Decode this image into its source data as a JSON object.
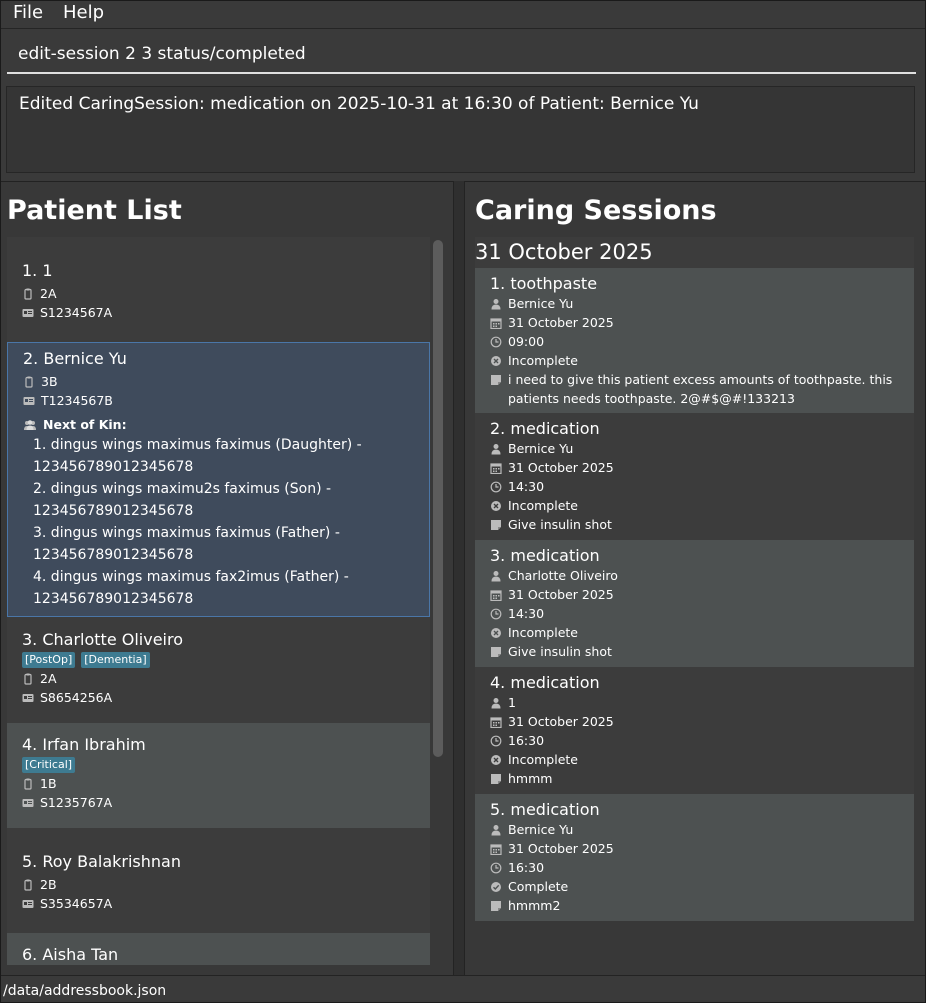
{
  "menu": {
    "file": "File",
    "help": "Help"
  },
  "command": {
    "value": "edit-session 2 3 status/completed"
  },
  "result": {
    "message": "Edited CaringSession: medication on 2025-10-31 at 16:30 of Patient: Bernice Yu"
  },
  "patient_list": {
    "title": "Patient List",
    "patients": [
      {
        "index_name": "1. 1",
        "ward": "2A",
        "nric": "S1234567A"
      },
      {
        "index_name": "2. Bernice Yu",
        "ward": "3B",
        "nric": "T1234567B",
        "nok_label": "Next of Kin:",
        "nok": [
          {
            "line1": "1. dingus wings maximus faximus (Daughter) -",
            "line2": "123456789012345678"
          },
          {
            "line1": "2. dingus wings maximu2s faximus (Son) -",
            "line2": "123456789012345678"
          },
          {
            "line1": "3. dingus wings maximus faximus (Father) -",
            "line2": "123456789012345678"
          },
          {
            "line1": "4. dingus wings maximus fax2imus (Father) -",
            "line2": "123456789012345678"
          }
        ]
      },
      {
        "index_name": "3. Charlotte Oliveiro",
        "tags": [
          "[PostOp]",
          "[Dementia]"
        ],
        "ward": "2A",
        "nric": "S8654256A"
      },
      {
        "index_name": "4. Irfan Ibrahim",
        "tags": [
          "[Critical]"
        ],
        "ward": "1B",
        "nric": "S1235767A"
      },
      {
        "index_name": "5. Roy Balakrishnan",
        "ward": "2B",
        "nric": "S3534657A"
      },
      {
        "index_name": "6. Aisha Tan"
      }
    ]
  },
  "caring_sessions": {
    "title": "Caring Sessions",
    "date_header": "31 October 2025",
    "sessions": [
      {
        "title": "1. toothpaste",
        "patient": "Bernice Yu",
        "date": "31 October 2025",
        "time": "09:00",
        "status": "Incomplete",
        "note": "i need to give this patient excess amounts of toothpaste. this patients needs toothpaste. 2@#$@#!133213"
      },
      {
        "title": "2. medication",
        "patient": "Bernice Yu",
        "date": "31 October 2025",
        "time": "14:30",
        "status": "Incomplete",
        "note": "Give insulin shot"
      },
      {
        "title": "3. medication",
        "patient": "Charlotte Oliveiro",
        "date": "31 October 2025",
        "time": "14:30",
        "status": "Incomplete",
        "note": "Give insulin shot"
      },
      {
        "title": "4. medication",
        "patient": "1",
        "date": "31 October 2025",
        "time": "16:30",
        "status": "Incomplete",
        "note": "hmmm"
      },
      {
        "title": "5. medication",
        "patient": "Bernice Yu",
        "date": "31 October 2025",
        "time": "16:30",
        "status": "Complete",
        "note": "hmmm2"
      }
    ]
  },
  "status_bar": {
    "path": "/data/addressbook.json"
  },
  "colors": {
    "tag_bg": "#3e7b91",
    "selected_bg": "#3f4b5c",
    "selected_border": "#4a76a8",
    "card_alt": "#4d5151"
  },
  "icons": [
    "ward-icon",
    "id-card-icon",
    "group-icon",
    "person-icon",
    "calendar-icon",
    "clock-icon",
    "x-circle-icon",
    "check-circle-icon",
    "note-icon"
  ]
}
